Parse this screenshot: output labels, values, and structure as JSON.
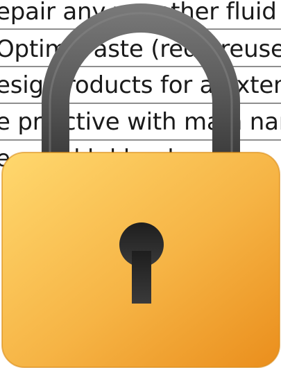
{
  "document": {
    "lines": [
      "epair any w     r other fluid",
      "Optimis    aste (redu    reuse",
      "esign  roducts for an  xtend",
      "e pro  ctive with main   nanc",
      "e  ns  e  l  h  l  l   e  d  "
    ]
  },
  "lock": {
    "icon": "padlock-icon",
    "body_color_light": "#ffd86e",
    "body_color_dark": "#ea8e1c",
    "shackle_color": "#5a5a5a",
    "keyhole_color": "#2a2a2a"
  }
}
